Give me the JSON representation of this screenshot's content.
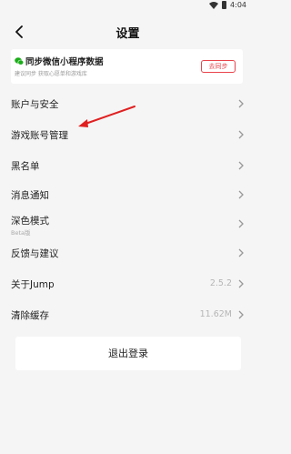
{
  "status_bar": {
    "time": "4:04"
  },
  "nav": {
    "title": "设置"
  },
  "sync_card": {
    "title": "同步微信小程序数据",
    "subtitle": "建议同步 获取心愿单和游戏库",
    "button_label": "去同步"
  },
  "rows": [
    {
      "label": "账户与安全"
    },
    {
      "label": "游戏账号管理"
    },
    {
      "label": "黑名单"
    },
    {
      "label": "消息通知"
    },
    {
      "label": "深色模式",
      "sub": "Beta版"
    },
    {
      "label": "反馈与建议"
    },
    {
      "label": "关于Jump",
      "value": "2.5.2"
    },
    {
      "label": "清除缓存",
      "value": "11.62M"
    }
  ],
  "logout_label": "退出登录",
  "colors": {
    "accent": "#e8434b",
    "wechat": "#1aad19",
    "annotation_arrow": "#e02020"
  },
  "icons": [
    "wifi-icon",
    "battery-icon",
    "back-icon",
    "wechat-icon",
    "chevron-right-icon"
  ]
}
